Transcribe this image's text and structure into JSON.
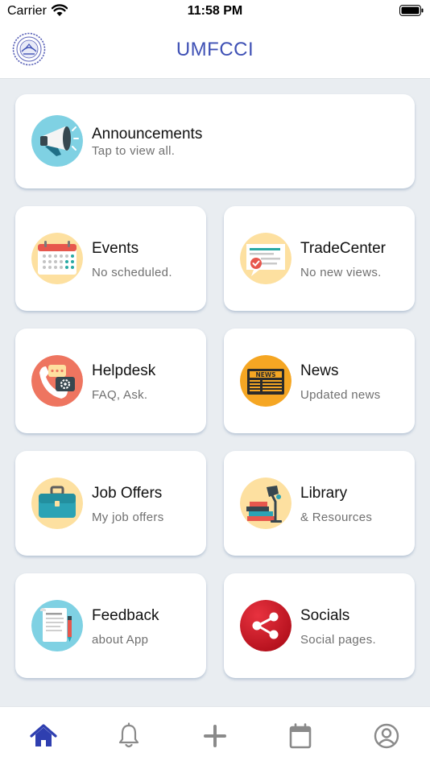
{
  "status_bar": {
    "carrier": "Carrier",
    "time": "11:58 PM"
  },
  "header": {
    "title": "UMFCCI"
  },
  "cards": {
    "announcements": {
      "title": "Announcements",
      "subtitle": "Tap to view all."
    },
    "events": {
      "title": "Events",
      "subtitle": "No scheduled."
    },
    "tradecenter": {
      "title": "TradeCenter",
      "subtitle": "No new views."
    },
    "helpdesk": {
      "title": "Helpdesk",
      "subtitle": "FAQ, Ask."
    },
    "news": {
      "title": "News",
      "subtitle": "Updated news",
      "badge": "NEWS"
    },
    "job_offers": {
      "title": "Job Offers",
      "subtitle": "My job offers"
    },
    "library": {
      "title": "Library",
      "subtitle": "& Resources"
    },
    "feedback": {
      "title": "Feedback",
      "subtitle": "about App"
    },
    "socials": {
      "title": "Socials",
      "subtitle": "Social pages."
    }
  },
  "tab_bar": {
    "items": [
      {
        "icon": "home-icon",
        "active": true
      },
      {
        "icon": "bell-icon",
        "active": false
      },
      {
        "icon": "plus-icon",
        "active": false
      },
      {
        "icon": "calendar-icon",
        "active": false
      },
      {
        "icon": "profile-icon",
        "active": false
      }
    ]
  },
  "colors": {
    "accent": "#3f51b5",
    "active_tab": "#2f3fb0",
    "inactive_tab": "#8a8a8a",
    "background": "#e9edf1"
  }
}
